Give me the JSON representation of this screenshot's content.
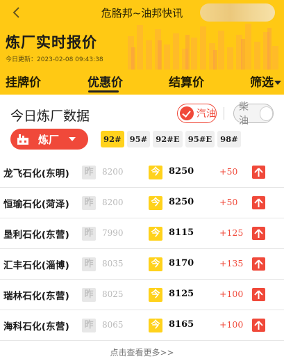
{
  "nav": {
    "title": "危胳邦~油邦快讯"
  },
  "header": {
    "title": "炼厂实时报价",
    "updated": "今日更新：2023-02-08 09:43:38"
  },
  "tabs": [
    {
      "label": "挂牌价",
      "active": false
    },
    {
      "label": "优惠价",
      "active": true
    },
    {
      "label": "结算价",
      "active": false
    },
    {
      "label": "筛选",
      "active": false
    }
  ],
  "panel": {
    "section_title": "今日炼厂数据",
    "gasoline_label": "汽油",
    "diesel_label": "柴油",
    "refinery_label": "炼厂",
    "grades": [
      "92#",
      "95#",
      "92#E",
      "95#E",
      "98#"
    ],
    "active_grade": "92#"
  },
  "rows": [
    {
      "name": "龙飞石化(东明)",
      "yest_badge": "昨",
      "yesterday": "8200",
      "today_badge": "今",
      "today": "8250",
      "change": "+50"
    },
    {
      "name": "恒瑜石化(菏泽)",
      "yest_badge": "昨",
      "yesterday": "8200",
      "today_badge": "今",
      "today": "8250",
      "change": "+50"
    },
    {
      "name": "垦利石化(东营)",
      "yest_badge": "昨",
      "yesterday": "7990",
      "today_badge": "今",
      "today": "8115",
      "change": "+125"
    },
    {
      "name": "汇丰石化(淄博)",
      "yest_badge": "昨",
      "yesterday": "8035",
      "today_badge": "今",
      "today": "8170",
      "change": "+135"
    },
    {
      "name": "瑞林石化(东营)",
      "yest_badge": "昨",
      "yesterday": "8025",
      "today_badge": "今",
      "today": "8125",
      "change": "+100"
    },
    {
      "name": "海科石化(东营)",
      "yest_badge": "昨",
      "yesterday": "8065",
      "today_badge": "今",
      "today": "8165",
      "change": "+100"
    }
  ],
  "footer": {
    "more": "点击查看更多>>"
  },
  "colors": {
    "brand": "#ffc914",
    "accent": "#f0493a",
    "active_grade": "#ffd21c"
  }
}
